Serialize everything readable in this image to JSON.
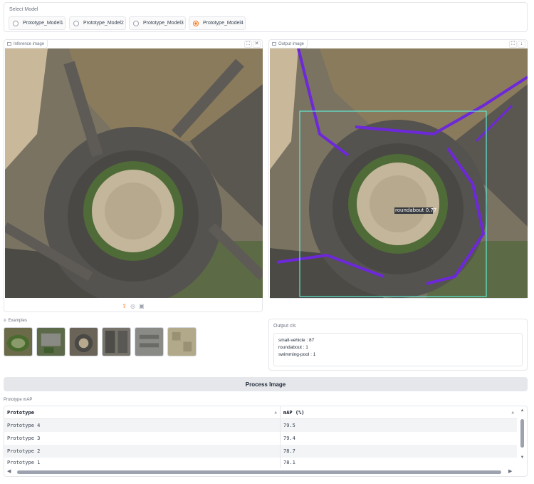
{
  "model_selector": {
    "title": "Select Model",
    "options": [
      "Prototype_Model1",
      "Prototype_Model2",
      "Prototype_Model3",
      "Prototype_Model4"
    ],
    "selected": "Prototype_Model4"
  },
  "inference_panel": {
    "label": "Inference image"
  },
  "output_panel": {
    "label": "Output image",
    "detection_label": "roundabout 0.77",
    "box_colors": {
      "small_vehicle": "#6d28d9",
      "roundabout": "#5eead4"
    }
  },
  "examples": {
    "title": "Examples",
    "count": 6
  },
  "output_cls": {
    "title": "Output cls",
    "lines": [
      "small-vehicle : 87",
      "roundabout : 1",
      "swimming-pool : 1"
    ]
  },
  "process_button": {
    "label": "Process Image"
  },
  "map_table": {
    "title": "Prototype mAP",
    "headers": [
      "Prototype",
      "mAP (%)"
    ],
    "rows": [
      [
        "Prototype 4",
        "79.5"
      ],
      [
        "Prototype 3",
        "79.4"
      ],
      [
        "Prototype 2",
        "78.7"
      ],
      [
        "Prototype 1",
        "78.1"
      ]
    ]
  },
  "colors": {
    "accent": "#f97316",
    "button_bg": "#e5e7eb"
  }
}
